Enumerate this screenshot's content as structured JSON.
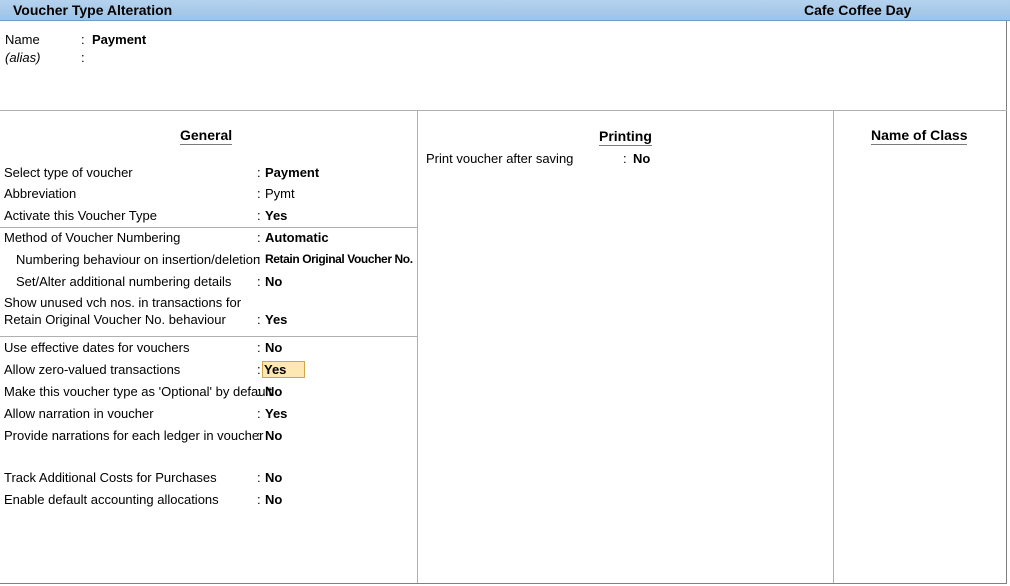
{
  "window": {
    "title": "Voucher Type Alteration",
    "company": "Cafe Coffee Day"
  },
  "header": {
    "name_label": "Name",
    "name_sep": ":",
    "name_value": "Payment",
    "alias_label": "(alias)",
    "alias_sep": ":"
  },
  "sections": {
    "general": "General",
    "printing": "Printing",
    "name_of_class": "Name of Class"
  },
  "general": {
    "select_type": {
      "label": "Select type of voucher",
      "sep": ":",
      "value": "Payment"
    },
    "abbreviation": {
      "label": "Abbreviation",
      "sep": ":",
      "value": "Pymt"
    },
    "activate": {
      "label": "Activate this Voucher Type",
      "sep": ":",
      "value": "Yes"
    },
    "method_numbering": {
      "label": "Method of Voucher Numbering",
      "sep": ":",
      "value": "Automatic"
    },
    "numbering_behaviour": {
      "label": "Numbering behaviour on insertion/deletion",
      "sep": ":",
      "value": "Retain Original Voucher No."
    },
    "set_alter_numbering": {
      "label": "Set/Alter additional numbering details",
      "sep": ":",
      "value": "No"
    },
    "show_unused": {
      "label_line1": "Show unused vch nos. in transactions for",
      "label_line2": "Retain Original Voucher No. behaviour",
      "sep": ":",
      "value": "Yes"
    },
    "effective_dates": {
      "label": "Use effective dates for vouchers",
      "sep": ":",
      "value": "No"
    },
    "zero_valued": {
      "label": "Allow zero-valued transactions",
      "sep": ":",
      "value": "Yes"
    },
    "optional_default": {
      "label": "Make this voucher type as 'Optional' by default",
      "sep": ":",
      "value": "No"
    },
    "narration": {
      "label": "Allow narration in voucher",
      "sep": ":",
      "value": "Yes"
    },
    "narration_each_ledger": {
      "label": "Provide narrations for each ledger in voucher",
      "sep": ":",
      "value": "No"
    },
    "track_additional_costs": {
      "label": "Track Additional Costs for Purchases",
      "sep": ":",
      "value": "No"
    },
    "default_allocations": {
      "label": "Enable default accounting allocations",
      "sep": ":",
      "value": "No"
    }
  },
  "printing": {
    "print_after_saving": {
      "label": "Print voucher after saving",
      "sep": ":",
      "value": "No"
    }
  },
  "colors": {
    "titlebar": "#a9cbec",
    "highlight": "#fde8b3"
  }
}
